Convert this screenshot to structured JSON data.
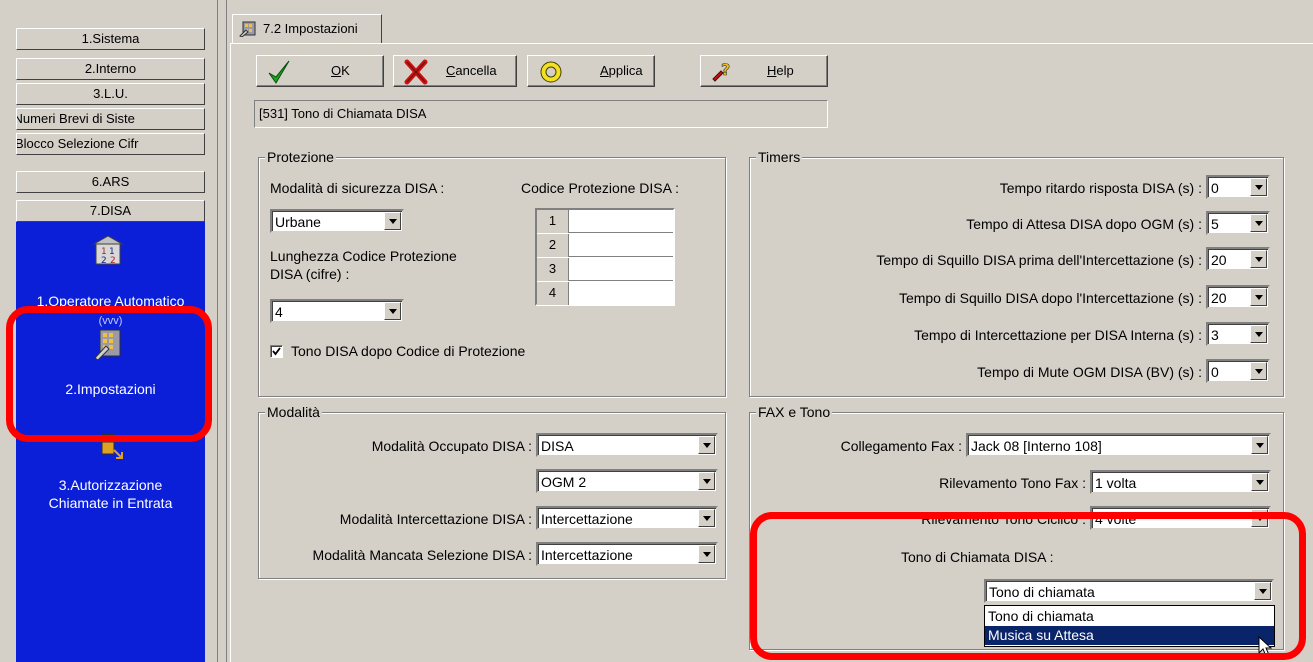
{
  "sidebar": {
    "items": [
      {
        "label": "1.Sistema"
      },
      {
        "label": "2.Interno"
      },
      {
        "label": "3.L.U."
      },
      {
        "label": "enda Numeri Brevi di Siste"
      },
      {
        "label": "TRS (Blocco Selezione Cifr"
      },
      {
        "label": "6.ARS"
      },
      {
        "label": "7.DISA"
      }
    ],
    "subitems": [
      {
        "label": "1.Operatore Automatico",
        "icon": "auto-attendant-icon"
      },
      {
        "label": "2.Impostazioni",
        "icon": "settings-icon"
      },
      {
        "label_line1": "3.Autorizzazione",
        "label_line2": "Chiamate in Entrata",
        "icon": "incoming-call-icon"
      }
    ],
    "overflow_text": "(vvv)"
  },
  "tab": {
    "label": "7.2 Impostazioni"
  },
  "toolbar": {
    "ok": "OK",
    "cancel": "Cancella",
    "apply": "Applica",
    "help": "Help"
  },
  "parameter": "[531] Tono di Chiamata DISA",
  "protezione": {
    "title": "Protezione",
    "mode_label": "Modalità di sicurezza DISA :",
    "mode_value": "Urbane",
    "code_label": "Codice Protezione DISA :",
    "code_rows": [
      "1",
      "2",
      "3",
      "4"
    ],
    "length_label_line1": "Lunghezza Codice Protezione",
    "length_label_line2": "DISA (cifre) :",
    "length_value": "4",
    "tone_checkbox_label": "Tono DISA dopo Codice di Protezione",
    "tone_checkbox_checked": true
  },
  "timers": {
    "title": "Timers",
    "rows": [
      {
        "label": "Tempo ritardo risposta DISA (s) :",
        "value": "0"
      },
      {
        "label": "Tempo di Attesa DISA dopo OGM (s) :",
        "value": "5"
      },
      {
        "label": "Tempo di Squillo DISA prima dell'Intercettazione (s) :",
        "value": "20"
      },
      {
        "label": "Tempo di Squillo DISA dopo l'Intercettazione (s) :",
        "value": "20"
      },
      {
        "label": "Tempo di Intercettazione per DISA Interna (s) :",
        "value": "3"
      },
      {
        "label": "Tempo di Mute OGM DISA (BV) (s) :",
        "value": "0"
      }
    ]
  },
  "modalita": {
    "title": "Modalità",
    "busy_label": "Modalità Occupato DISA :",
    "busy_value": "DISA",
    "busy_value2": "OGM 2",
    "intercept_label": "Modalità Intercettazione DISA :",
    "intercept_value": "Intercettazione",
    "missed_label": "Modalità Mancata Selezione DISA :",
    "missed_value": "Intercettazione"
  },
  "fax": {
    "title": "FAX e Tono",
    "connection_label": "Collegamento Fax :",
    "connection_value": "Jack 08 [Interno 108]",
    "fax_detect_label": "Rilevamento Tono Fax :",
    "fax_detect_value": "1 volta",
    "cyclic_label": "Rilevamento Tono Ciclico :",
    "cyclic_value": "4 volte",
    "ring_label": "Tono di Chiamata DISA :",
    "ring_value": "Tono di chiamata",
    "ring_options": [
      "Tono di chiamata",
      "Musica su Attesa"
    ],
    "ring_highlighted": "Musica su Attesa"
  },
  "colors": {
    "panel": "#d4d0c8",
    "nav_blue": "#0b1fd8",
    "selection": "#0a246a",
    "highlight_red": "#ff0000"
  }
}
